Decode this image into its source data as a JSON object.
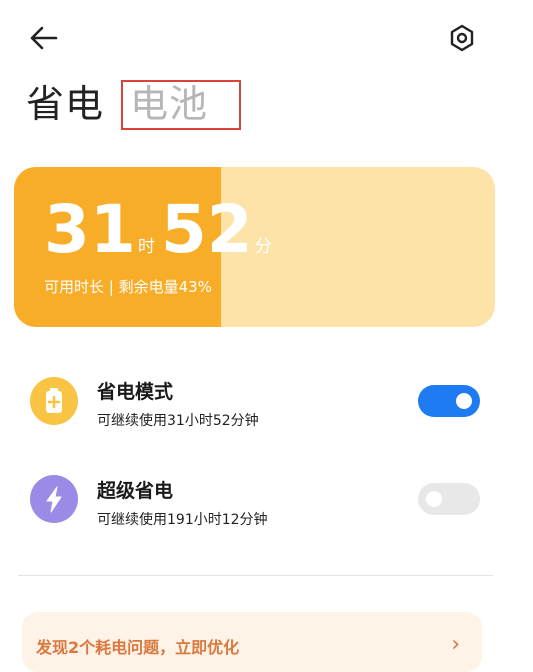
{
  "header": {
    "back_icon": "arrow-left-icon",
    "settings_icon": "hexagon-gear-icon"
  },
  "title": {
    "main": "省电",
    "alternative": "电池"
  },
  "battery": {
    "hours": "31",
    "hours_unit": "时",
    "minutes": "52",
    "minutes_unit": "分",
    "subtitle": "可用时长 | 剩余电量43%",
    "level_percent": 43,
    "fill_color": "#f8ad28",
    "track_color": "#fde3a8"
  },
  "modes": [
    {
      "title": "省电模式",
      "subtitle": "可继续使用31小时52分钟",
      "icon": "battery-plus-icon",
      "icon_color": "#f9c443",
      "enabled": true
    },
    {
      "title": "超级省电",
      "subtitle": "可继续使用191小时12分钟",
      "icon": "lightning-icon",
      "icon_color": "#9c8be6",
      "enabled": false
    }
  ],
  "banner": {
    "text": "发现2个耗电问题，立即优化",
    "chevron_icon": "chevron-right-icon"
  },
  "colors": {
    "toggle_on": "#1f7bf2",
    "toggle_off": "#e8e8e8"
  }
}
